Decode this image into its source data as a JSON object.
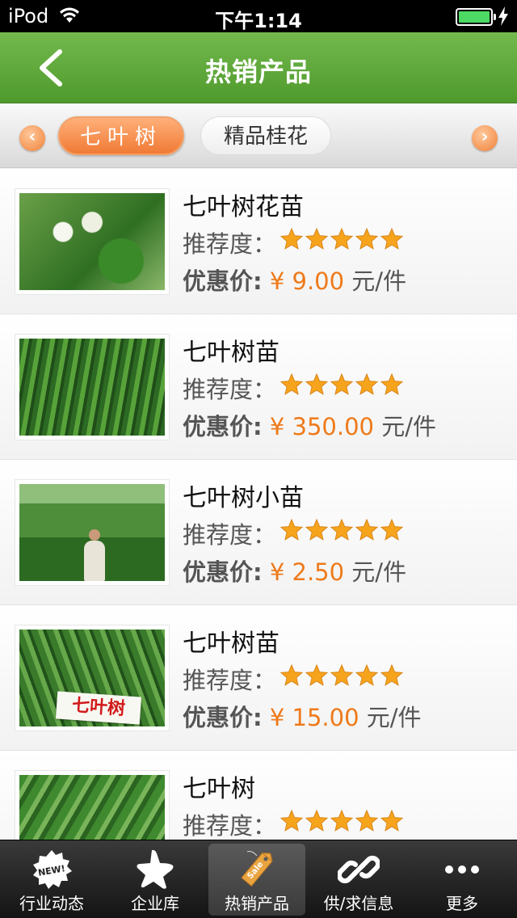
{
  "status_bar": {
    "carrier": "iPod",
    "time": "下午1:14"
  },
  "navbar": {
    "title": "热销产品",
    "back_icon": "chevron-left-icon"
  },
  "categories": {
    "items": [
      "七叶树",
      "精品桂花"
    ],
    "active_index": 0
  },
  "labels": {
    "recommend": "推荐度：",
    "price_label": "优惠价:",
    "unit": "元/件"
  },
  "products": [
    {
      "name": "七叶树花苗",
      "rating": 5,
      "price": "¥ 9.00"
    },
    {
      "name": "七叶树苗",
      "rating": 5,
      "price": "¥ 350.00"
    },
    {
      "name": "七叶树小苗",
      "rating": 5,
      "price": "¥ 2.50"
    },
    {
      "name": "七叶树苗",
      "rating": 5,
      "price": "¥ 15.00",
      "sign_text": "七叶树"
    },
    {
      "name": "七叶树",
      "rating": 5
    }
  ],
  "tabs": [
    {
      "label": "行业动态",
      "icon": "new-badge-icon",
      "badge_text": "NEW!"
    },
    {
      "label": "企业库",
      "icon": "star-icon"
    },
    {
      "label": "热销产品",
      "icon": "sale-tag-icon",
      "badge_text": "Sale",
      "selected": true
    },
    {
      "label": "供/求信息",
      "icon": "link-icon"
    },
    {
      "label": "更多",
      "icon": "more-dots-icon"
    }
  ],
  "colors": {
    "nav_green": "#5fa83b",
    "accent_orange": "#ee7a1a",
    "star": "#f7a41d"
  }
}
